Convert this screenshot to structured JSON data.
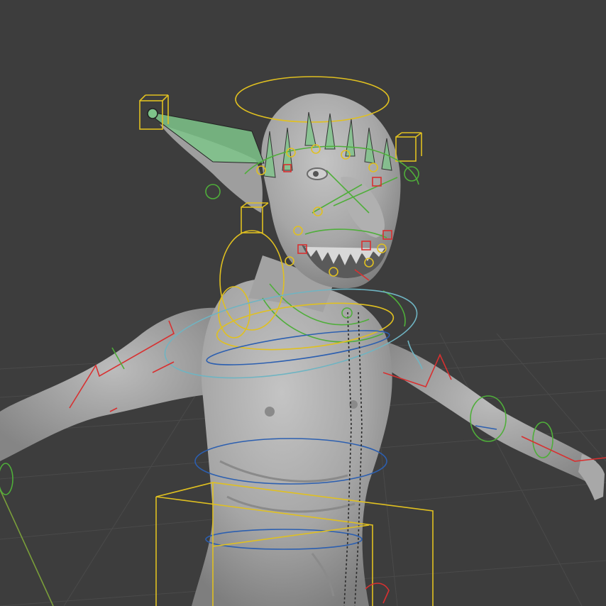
{
  "viewport": {
    "background": "#3d3d3d",
    "grid_color": "#4a4a4a",
    "mesh_color": "#9a9a9a"
  },
  "overlay_colors": {
    "yellow": "#e0c020",
    "green": "#4fae3a",
    "red": "#d83030",
    "blue": "#2c5fb0",
    "cyan": "#6fb4c2",
    "bone_fill": "#7ec48a"
  },
  "icons": {
    "ear-bone": "bone-shape",
    "rig-controls": "control-widgets",
    "model": "goblin-character-mesh"
  }
}
